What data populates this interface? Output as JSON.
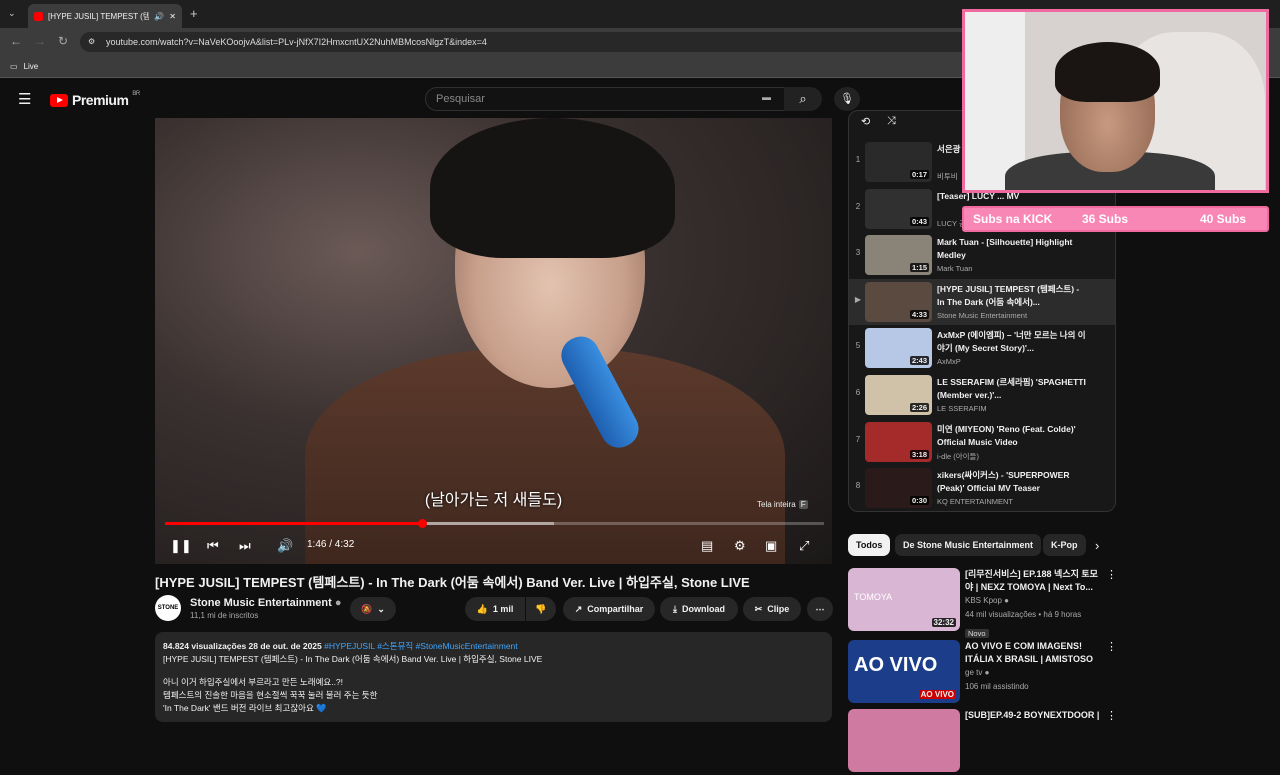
{
  "browser": {
    "tab_title": "[HYPE JUSIL] TEMPEST (템페",
    "url": "youtube.com/watch?v=NaVeKOoojvA&list=PLv-jNfX7I2HmxcntUX2NuhMBMcosNlgzT&index=4",
    "bookmark": "Live"
  },
  "header": {
    "logo": "Premium",
    "region": "BR",
    "search_placeholder": "Pesquisar"
  },
  "player": {
    "subtitle": "(날아가는 저 새들도)",
    "fullscreen_tip": "Tela inteira",
    "fullscreen_key": "F",
    "time": "1:46 / 4:32",
    "progress": 0.39,
    "buffered": 0.59
  },
  "video": {
    "title": "[HYPE JUSIL] TEMPEST (템페스트) - In The Dark (어둠 속에서) Band Ver. Live | 하입주실, Stone LIVE",
    "channel": "Stone Music Entertainment",
    "channel_avatar": "STONE",
    "subscribers": "11,1 mi de inscritos",
    "likes": "1 mil",
    "share": "Compartilhar",
    "download": "Download",
    "clip": "Clipe"
  },
  "description": {
    "meta": "84.824 visualizações  28 de out. de 2025",
    "tags": "#HYPEJUSIL #스톤뮤직 #StoneMusicEntertainment",
    "line1": "[HYPE JUSIL] TEMPEST (템페스트) - In The Dark (어둠 속에서) Band Ver. Live | 하입주실, Stone LIVE",
    "line2": "아니 이거 하입주실에서 부르라고 만든 노래예요..?!",
    "line3": "템페스트의 진솔한 마음을 현소절씩 꾹꾹 눌러 불러 주는 듯한",
    "line4": "'In The Dark' 밴드 버전 라이브 최고잖아요 💙"
  },
  "playlist": [
    {
      "idx": "1",
      "title": "서은광 ... Light'",
      "channel": "비투비",
      "dur": "0:17",
      "color": "#2a2a2a"
    },
    {
      "idx": "2",
      "title": "[Teaser] LUCY ... MV",
      "channel": "LUCY 공식",
      "dur": "0:43",
      "color": "#303030"
    },
    {
      "idx": "3",
      "title": "Mark Tuan - [Silhouette] Highlight Medley",
      "channel": "Mark Tuan",
      "dur": "1:15",
      "color": "#8a8378"
    },
    {
      "idx": "▶",
      "title": "[HYPE JUSIL] TEMPEST (템페스트) - In The Dark (어둠 속에서)...",
      "channel": "Stone Music Entertainment",
      "dur": "4:33",
      "color": "#5a4a40"
    },
    {
      "idx": "5",
      "title": "AxMxP (에이엠피) – '너만 모르는 나의 이야기 (My Secret Story)'...",
      "channel": "AxMxP",
      "dur": "2:43",
      "color": "#b7c7e6"
    },
    {
      "idx": "6",
      "title": "LE SSERAFIM (르세라핌) 'SPAGHETTI (Member ver.)'...",
      "channel": "LE SSERAFIM",
      "dur": "2:26",
      "color": "#cfc2a8"
    },
    {
      "idx": "7",
      "title": "미연 (MIYEON) 'Reno (Feat. Colde)' Official Music Video",
      "channel": "i-dle (아이들)",
      "dur": "3:18",
      "color": "#a52a2a"
    },
    {
      "idx": "8",
      "title": "xikers(싸이커스) - 'SUPERPOWER (Peak)' Official MV Teaser",
      "channel": "KQ ENTERTAINMENT",
      "dur": "0:30",
      "color": "#2a1a1a"
    }
  ],
  "chips": [
    "Todos",
    "De Stone Music Entertainment",
    "K-Pop"
  ],
  "recommendations": [
    {
      "title": "[리무진서비스] EP.188 넥스지 토모야 | NEXZ TOMOYA | Next To...",
      "channel": "KBS Kpop",
      "meta": "44 mil visualizações • há 9 horas",
      "badge": "Novo",
      "dur": "32:32",
      "thumb_text": "TOMOYA",
      "color": "#d9b6d4"
    },
    {
      "title": "AO VIVO E COM IMAGENS! ITÁLIA X BRASIL | AMISTOSO ...",
      "channel": "ge tv",
      "meta": "106 mil assistindo",
      "badge": "",
      "dur": "AO VIVO",
      "thumb_text": "AO VIVO",
      "color": "#1c3d8a"
    },
    {
      "title": "[SUB]EP.49-2 BOYNEXTDOOR |",
      "channel": "",
      "meta": "",
      "badge": "",
      "dur": "",
      "thumb_text": "",
      "color": "#cf7aa0"
    }
  ],
  "overlay": {
    "subs_label": "Subs na KICK",
    "subs_current": "36 Subs",
    "subs_goal": "40 Subs"
  },
  "colors": {
    "accent": "#ff0000",
    "overlay_pink": "#f887b5"
  }
}
